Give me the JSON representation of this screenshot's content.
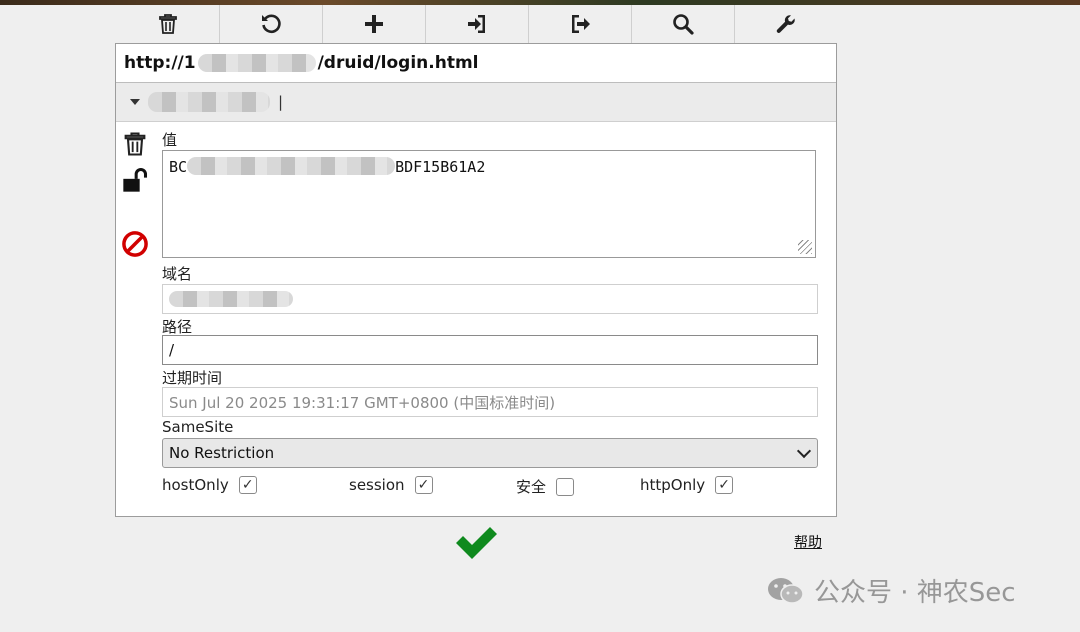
{
  "toolbar": {
    "buttons": [
      "trash-icon",
      "refresh-icon",
      "plus-icon",
      "import-icon",
      "export-icon",
      "search-icon",
      "wrench-icon"
    ]
  },
  "url": {
    "prefix": "http://1",
    "suffix": "/druid/login.html"
  },
  "cookie": {
    "name_suffix": "|",
    "value_label": "值",
    "value_prefix": "BC",
    "value_suffix": "BDF15B61A2",
    "domain_label": "域名",
    "path_label": "路径",
    "path_value": "/",
    "expires_label": "过期时间",
    "expires_value": "Sun Jul 20 2025 19:31:17 GMT+0800 (中国标准时间)",
    "samesite_label": "SameSite",
    "samesite_value": "No Restriction"
  },
  "flags": [
    {
      "label": "hostOnly",
      "checked": true,
      "mark": "✓"
    },
    {
      "label": "session",
      "checked": true,
      "mark": "✓"
    },
    {
      "label": "安全",
      "checked": false,
      "mark": ""
    },
    {
      "label": "httpOnly",
      "checked": true,
      "mark": "✓"
    }
  ],
  "footer": {
    "help_label": "帮助"
  },
  "watermark": {
    "text": "公众号 · 神农Sec"
  },
  "colors": {
    "ok_green": "#0f8a1e",
    "block_red": "#d10000"
  }
}
